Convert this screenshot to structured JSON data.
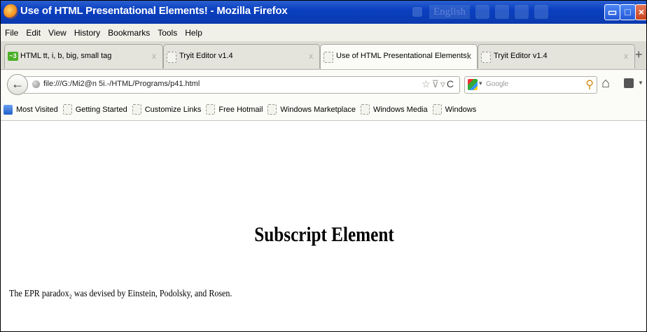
{
  "window": {
    "title": "Use of HTML Presentational Elements! - Mozilla Firefox",
    "language_button": "English"
  },
  "menu": [
    "File",
    "Edit",
    "View",
    "History",
    "Bookmarks",
    "Tools",
    "Help"
  ],
  "tabs": [
    {
      "label": "HTML tt, i, b, big, small tag",
      "close": "x"
    },
    {
      "label": "Tryit Editor v1.4",
      "close": "x"
    },
    {
      "label": "Use of HTML Presentational Elements!",
      "close": "x"
    },
    {
      "label": "Tryit Editor v1.4",
      "close": "x"
    }
  ],
  "new_tab": "+",
  "nav": {
    "url": "file:///G:/Mi2@n 5i.-/HTML/Programs/p41.html",
    "search_placeholder": "Google"
  },
  "bookmarks": [
    "Most Visited",
    "Getting Started",
    "Customize Links",
    "Free Hotmail",
    "Windows Marketplace",
    "Windows Media",
    "Windows"
  ],
  "page": {
    "heading": "Subscript Element",
    "paragraph": "The EPR paradox₂ was devised by Einstein, Podolsky, and Rosen."
  }
}
